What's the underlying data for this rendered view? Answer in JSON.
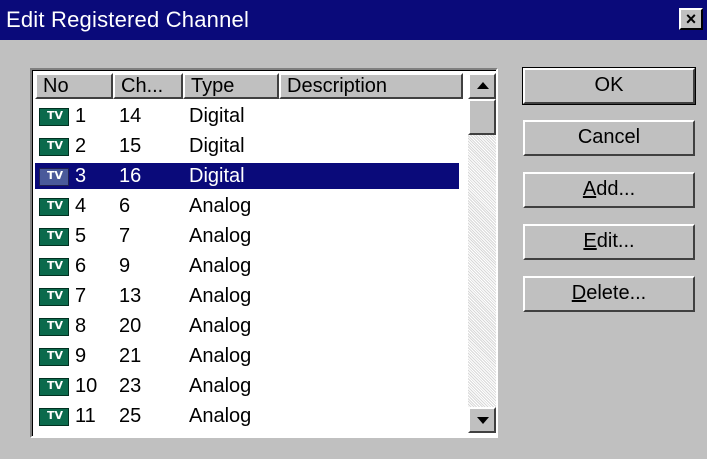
{
  "window": {
    "title": "Edit Registered Channel",
    "close_label": "×"
  },
  "list": {
    "columns": [
      "No",
      "Ch...",
      "Type",
      "Description"
    ],
    "rows": [
      {
        "no": "1",
        "ch": "14",
        "type": "Digital",
        "description": "",
        "icon": "tv-icon"
      },
      {
        "no": "2",
        "ch": "15",
        "type": "Digital",
        "description": "",
        "icon": "tv-icon"
      },
      {
        "no": "3",
        "ch": "16",
        "type": "Digital",
        "description": "",
        "icon": "tv-icon",
        "selected": true
      },
      {
        "no": "4",
        "ch": "6",
        "type": "Analog",
        "description": "",
        "icon": "tv-icon"
      },
      {
        "no": "5",
        "ch": "7",
        "type": "Analog",
        "description": "",
        "icon": "tv-icon"
      },
      {
        "no": "6",
        "ch": "9",
        "type": "Analog",
        "description": "",
        "icon": "tv-icon"
      },
      {
        "no": "7",
        "ch": "13",
        "type": "Analog",
        "description": "",
        "icon": "tv-icon"
      },
      {
        "no": "8",
        "ch": "20",
        "type": "Analog",
        "description": "",
        "icon": "tv-icon"
      },
      {
        "no": "9",
        "ch": "21",
        "type": "Analog",
        "description": "",
        "icon": "tv-icon"
      },
      {
        "no": "10",
        "ch": "23",
        "type": "Analog",
        "description": "",
        "icon": "tv-icon"
      },
      {
        "no": "11",
        "ch": "25",
        "type": "Analog",
        "description": "",
        "icon": "tv-icon"
      }
    ]
  },
  "buttons": {
    "ok": "OK",
    "cancel": "Cancel",
    "add_mnemonic": "A",
    "add_rest": "dd...",
    "edit_mnemonic": "E",
    "edit_rest": "dit...",
    "delete_mnemonic": "D",
    "delete_rest": "elete..."
  },
  "colors": {
    "titlebar": "#0a0a7a",
    "selection": "#0a0a7a",
    "face": "#c0c0c0"
  }
}
